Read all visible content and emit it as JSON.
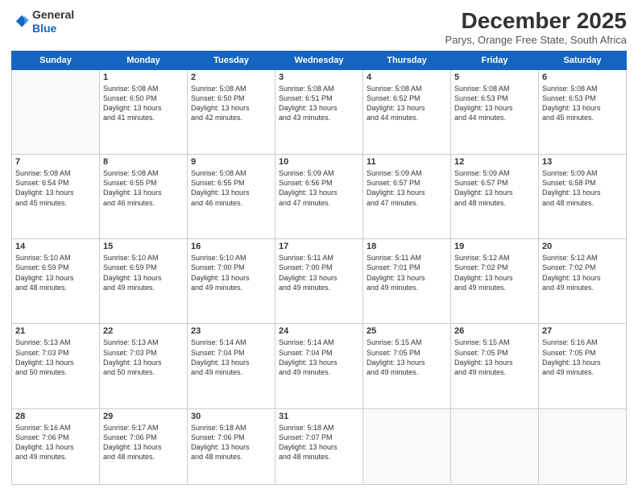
{
  "header": {
    "logo_line1": "General",
    "logo_line2": "Blue",
    "month": "December 2025",
    "location": "Parys, Orange Free State, South Africa"
  },
  "days_of_week": [
    "Sunday",
    "Monday",
    "Tuesday",
    "Wednesday",
    "Thursday",
    "Friday",
    "Saturday"
  ],
  "weeks": [
    [
      {
        "num": "",
        "info": ""
      },
      {
        "num": "1",
        "info": "Sunrise: 5:08 AM\nSunset: 6:50 PM\nDaylight: 13 hours\nand 41 minutes."
      },
      {
        "num": "2",
        "info": "Sunrise: 5:08 AM\nSunset: 6:50 PM\nDaylight: 13 hours\nand 42 minutes."
      },
      {
        "num": "3",
        "info": "Sunrise: 5:08 AM\nSunset: 6:51 PM\nDaylight: 13 hours\nand 43 minutes."
      },
      {
        "num": "4",
        "info": "Sunrise: 5:08 AM\nSunset: 6:52 PM\nDaylight: 13 hours\nand 44 minutes."
      },
      {
        "num": "5",
        "info": "Sunrise: 5:08 AM\nSunset: 6:53 PM\nDaylight: 13 hours\nand 44 minutes."
      },
      {
        "num": "6",
        "info": "Sunrise: 5:08 AM\nSunset: 6:53 PM\nDaylight: 13 hours\nand 45 minutes."
      }
    ],
    [
      {
        "num": "7",
        "info": "Sunrise: 5:08 AM\nSunset: 6:54 PM\nDaylight: 13 hours\nand 45 minutes."
      },
      {
        "num": "8",
        "info": "Sunrise: 5:08 AM\nSunset: 6:55 PM\nDaylight: 13 hours\nand 46 minutes."
      },
      {
        "num": "9",
        "info": "Sunrise: 5:08 AM\nSunset: 6:55 PM\nDaylight: 13 hours\nand 46 minutes."
      },
      {
        "num": "10",
        "info": "Sunrise: 5:09 AM\nSunset: 6:56 PM\nDaylight: 13 hours\nand 47 minutes."
      },
      {
        "num": "11",
        "info": "Sunrise: 5:09 AM\nSunset: 6:57 PM\nDaylight: 13 hours\nand 47 minutes."
      },
      {
        "num": "12",
        "info": "Sunrise: 5:09 AM\nSunset: 6:57 PM\nDaylight: 13 hours\nand 48 minutes."
      },
      {
        "num": "13",
        "info": "Sunrise: 5:09 AM\nSunset: 6:58 PM\nDaylight: 13 hours\nand 48 minutes."
      }
    ],
    [
      {
        "num": "14",
        "info": "Sunrise: 5:10 AM\nSunset: 6:59 PM\nDaylight: 13 hours\nand 48 minutes."
      },
      {
        "num": "15",
        "info": "Sunrise: 5:10 AM\nSunset: 6:59 PM\nDaylight: 13 hours\nand 49 minutes."
      },
      {
        "num": "16",
        "info": "Sunrise: 5:10 AM\nSunset: 7:00 PM\nDaylight: 13 hours\nand 49 minutes."
      },
      {
        "num": "17",
        "info": "Sunrise: 5:11 AM\nSunset: 7:00 PM\nDaylight: 13 hours\nand 49 minutes."
      },
      {
        "num": "18",
        "info": "Sunrise: 5:11 AM\nSunset: 7:01 PM\nDaylight: 13 hours\nand 49 minutes."
      },
      {
        "num": "19",
        "info": "Sunrise: 5:12 AM\nSunset: 7:02 PM\nDaylight: 13 hours\nand 49 minutes."
      },
      {
        "num": "20",
        "info": "Sunrise: 5:12 AM\nSunset: 7:02 PM\nDaylight: 13 hours\nand 49 minutes."
      }
    ],
    [
      {
        "num": "21",
        "info": "Sunrise: 5:13 AM\nSunset: 7:03 PM\nDaylight: 13 hours\nand 50 minutes."
      },
      {
        "num": "22",
        "info": "Sunrise: 5:13 AM\nSunset: 7:03 PM\nDaylight: 13 hours\nand 50 minutes."
      },
      {
        "num": "23",
        "info": "Sunrise: 5:14 AM\nSunset: 7:04 PM\nDaylight: 13 hours\nand 49 minutes."
      },
      {
        "num": "24",
        "info": "Sunrise: 5:14 AM\nSunset: 7:04 PM\nDaylight: 13 hours\nand 49 minutes."
      },
      {
        "num": "25",
        "info": "Sunrise: 5:15 AM\nSunset: 7:05 PM\nDaylight: 13 hours\nand 49 minutes."
      },
      {
        "num": "26",
        "info": "Sunrise: 5:15 AM\nSunset: 7:05 PM\nDaylight: 13 hours\nand 49 minutes."
      },
      {
        "num": "27",
        "info": "Sunrise: 5:16 AM\nSunset: 7:05 PM\nDaylight: 13 hours\nand 49 minutes."
      }
    ],
    [
      {
        "num": "28",
        "info": "Sunrise: 5:16 AM\nSunset: 7:06 PM\nDaylight: 13 hours\nand 49 minutes."
      },
      {
        "num": "29",
        "info": "Sunrise: 5:17 AM\nSunset: 7:06 PM\nDaylight: 13 hours\nand 48 minutes."
      },
      {
        "num": "30",
        "info": "Sunrise: 5:18 AM\nSunset: 7:06 PM\nDaylight: 13 hours\nand 48 minutes."
      },
      {
        "num": "31",
        "info": "Sunrise: 5:18 AM\nSunset: 7:07 PM\nDaylight: 13 hours\nand 48 minutes."
      },
      {
        "num": "",
        "info": ""
      },
      {
        "num": "",
        "info": ""
      },
      {
        "num": "",
        "info": ""
      }
    ]
  ]
}
